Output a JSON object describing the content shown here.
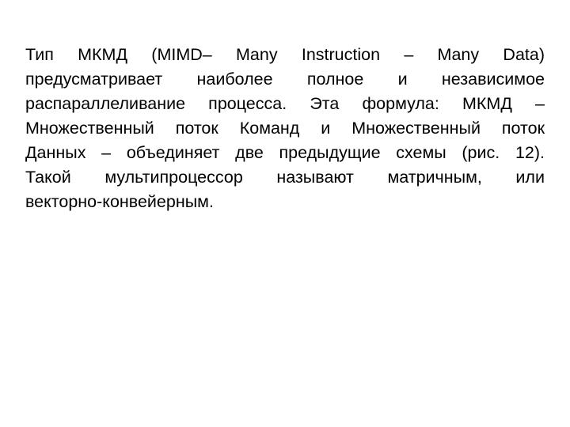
{
  "document": {
    "paragraph_lines": [
      "Тип МКМД (MIMD– Many Instruction – Many Data)",
      "предусматривает наиболее полное и независимое",
      "распараллеливание процесса. Эта формула: МКМД –",
      "Множественный поток Команд и Множественный поток",
      "Данных – объединяет две предыдущие схемы (рис. 12).",
      "Такой мультипроцессор называют матричным, или",
      "векторно-конвейерным."
    ],
    "text_color": "#000000",
    "background_color": "#ffffff"
  }
}
